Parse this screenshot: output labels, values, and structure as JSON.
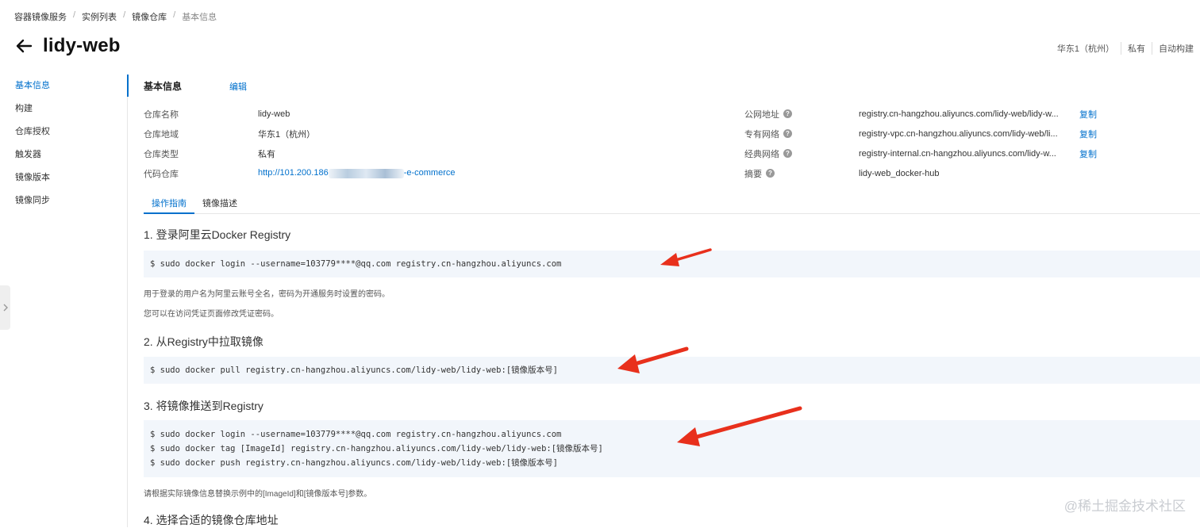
{
  "breadcrumb": {
    "items": [
      "容器镜像服务",
      "实例列表",
      "镜像仓库",
      "基本信息"
    ],
    "separator": "/"
  },
  "page": {
    "title": "lidy-web"
  },
  "meta": {
    "region": "华东1（杭州）",
    "type": "私有",
    "build": "自动构建"
  },
  "sidebar": {
    "items": [
      {
        "label": "基本信息",
        "active": true
      },
      {
        "label": "构建"
      },
      {
        "label": "仓库授权"
      },
      {
        "label": "触发器"
      },
      {
        "label": "镜像版本"
      },
      {
        "label": "镜像同步"
      }
    ]
  },
  "basic_info": {
    "title": "基本信息",
    "edit": "编辑",
    "left": [
      {
        "label": "仓库名称",
        "value": "lidy-web"
      },
      {
        "label": "仓库地域",
        "value": "华东1（杭州）"
      },
      {
        "label": "仓库类型",
        "value": "私有"
      },
      {
        "label": "代码仓库",
        "value_prefix": "http://101.200.186",
        "value_suffix": "-e-commerce"
      }
    ],
    "right": [
      {
        "label": "公网地址",
        "value": "registry.cn-hangzhou.aliyuncs.com/lidy-web/lidy-w...",
        "copy": "复制"
      },
      {
        "label": "专有网络",
        "value": "registry-vpc.cn-hangzhou.aliyuncs.com/lidy-web/li...",
        "copy": "复制"
      },
      {
        "label": "经典网络",
        "value": "registry-internal.cn-hangzhou.aliyuncs.com/lidy-w...",
        "copy": "复制"
      },
      {
        "label": "摘要",
        "value": "lidy-web_docker-hub"
      }
    ]
  },
  "tabs": [
    {
      "label": "操作指南",
      "active": true
    },
    {
      "label": "镜像描述"
    }
  ],
  "guide": {
    "step1": {
      "title": "1. 登录阿里云Docker Registry",
      "code": [
        "$ sudo docker login --username=103779****@qq.com registry.cn-hangzhou.aliyuncs.com"
      ],
      "notes": [
        "用于登录的用户名为阿里云账号全名，密码为开通服务时设置的密码。",
        "您可以在访问凭证页面修改凭证密码。"
      ]
    },
    "step2": {
      "title": "2. 从Registry中拉取镜像",
      "code": [
        "$ sudo docker pull registry.cn-hangzhou.aliyuncs.com/lidy-web/lidy-web:[镜像版本号]"
      ]
    },
    "step3": {
      "title": "3. 将镜像推送到Registry",
      "code": [
        "$ sudo docker login --username=103779****@qq.com registry.cn-hangzhou.aliyuncs.com",
        "$ sudo docker tag [ImageId] registry.cn-hangzhou.aliyuncs.com/lidy-web/lidy-web:[镜像版本号]",
        "$ sudo docker push registry.cn-hangzhou.aliyuncs.com/lidy-web/lidy-web:[镜像版本号]"
      ],
      "note": "请根据实际镜像信息替换示例中的[ImageId]和[镜像版本号]参数。"
    },
    "step4": {
      "title": "4. 选择合适的镜像仓库地址"
    }
  },
  "watermark": "@稀土掘金技术社区",
  "colors": {
    "accent": "#0070cc",
    "code_bg": "#f2f6fb",
    "annotation_arrow": "#e8301c"
  }
}
